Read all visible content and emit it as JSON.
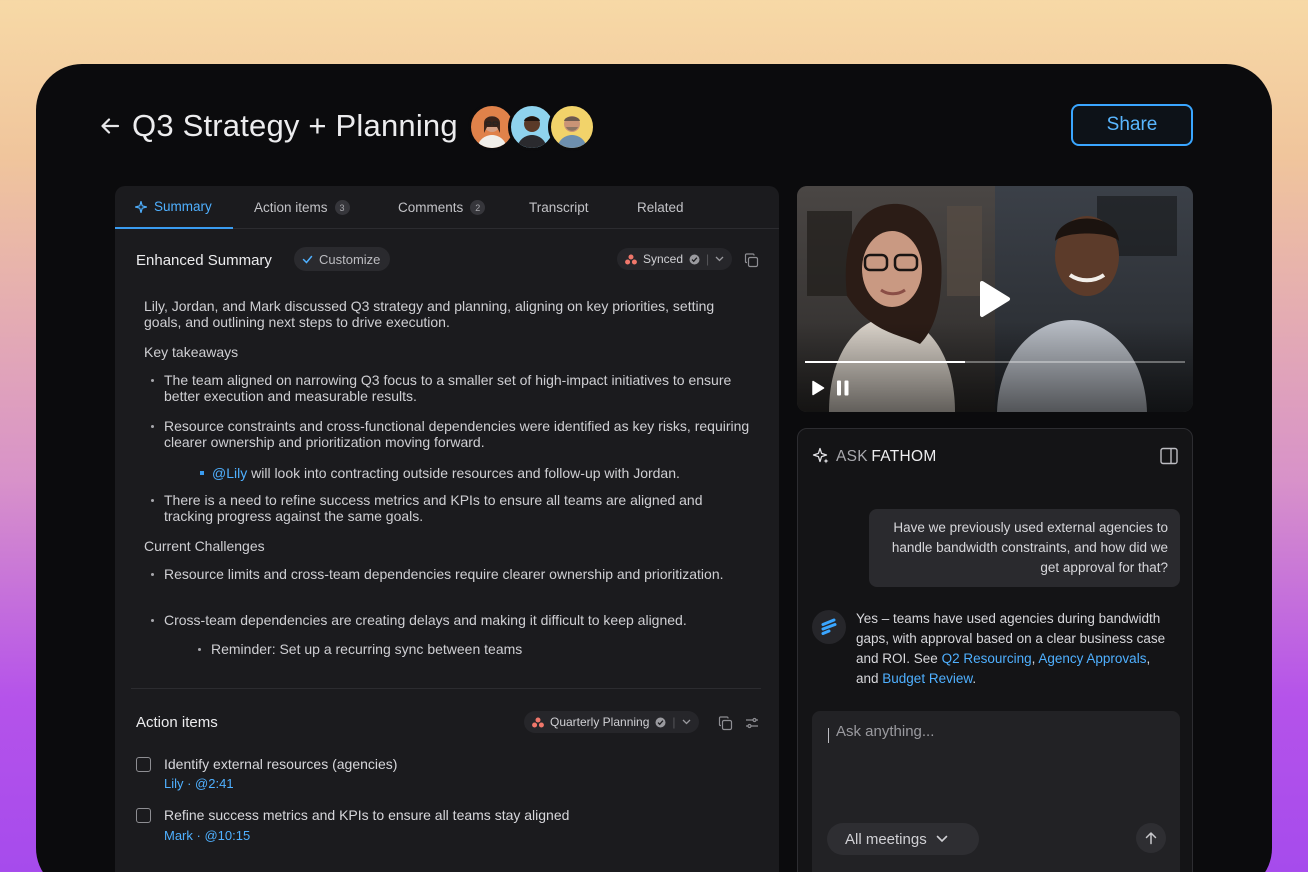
{
  "header": {
    "title": "Q3 Strategy + Planning",
    "share_label": "Share"
  },
  "tabs": [
    {
      "label": "Summary",
      "active": true
    },
    {
      "label": "Action items",
      "count": "3"
    },
    {
      "label": "Comments",
      "count": "2"
    },
    {
      "label": "Transcript"
    },
    {
      "label": "Related"
    }
  ],
  "summary": {
    "title": "Enhanced Summary",
    "customize_label": "Customize",
    "sync_label": "Synced",
    "intro": "Lily, Jordan, and Mark discussed Q3 strategy and planning, aligning on key priorities, setting goals, and outlining next steps to drive execution.",
    "key_takeaways_heading": "Key takeaways",
    "takeaways": [
      "The team aligned on narrowing Q3 focus to a smaller set of high-impact initiatives to ensure better execution and measurable results.",
      "Resource constraints and cross-functional dependencies were identified as key risks, requiring clearer ownership and prioritization moving forward.",
      "There is a need to refine success metrics and KPIs to ensure all teams are aligned and tracking progress against the same goals."
    ],
    "sub_item_mention": "@Lily",
    "sub_item_text": " will look into contracting outside resources and follow-up with Jordan.",
    "challenges_heading": "Current Challenges",
    "challenges": [
      "Resource limits and cross-team dependencies require clearer ownership and prioritization.",
      "Cross-team dependencies are creating delays and making it difficult to keep aligned."
    ],
    "reminder": "Reminder: Set up a recurring sync between teams"
  },
  "action_items": {
    "title": "Action items",
    "project_label": "Quarterly Planning",
    "items": [
      {
        "text": "Identify external resources (agencies)",
        "meta": "Lily · @2:41"
      },
      {
        "text": "Refine success metrics and KPIs to ensure all teams stay aligned",
        "meta": "Mark · @10:15"
      }
    ]
  },
  "video": {
    "progress": 0.42
  },
  "ask": {
    "title_prefix": "ASK",
    "title_brand": "FATHOM",
    "user_question": "Have we previously used external agencies to handle bandwidth constraints, and how did we get approval for that?",
    "answer_text_1": "Yes – teams have used agencies during bandwidth gaps, with approval based on a clear business case and ROI. See ",
    "link_1": "Q2 Resourcing",
    "answer_sep_1": ", ",
    "link_2": "Agency Approvals",
    "answer_sep_2": ", and ",
    "link_3": "Budget Review",
    "answer_end": ".",
    "input_placeholder": "Ask anything...",
    "scope_label": "All meetings"
  },
  "colors": {
    "accent": "#3aa6ff",
    "background": "#0b0b0d",
    "panel": "#1b1b1e"
  }
}
